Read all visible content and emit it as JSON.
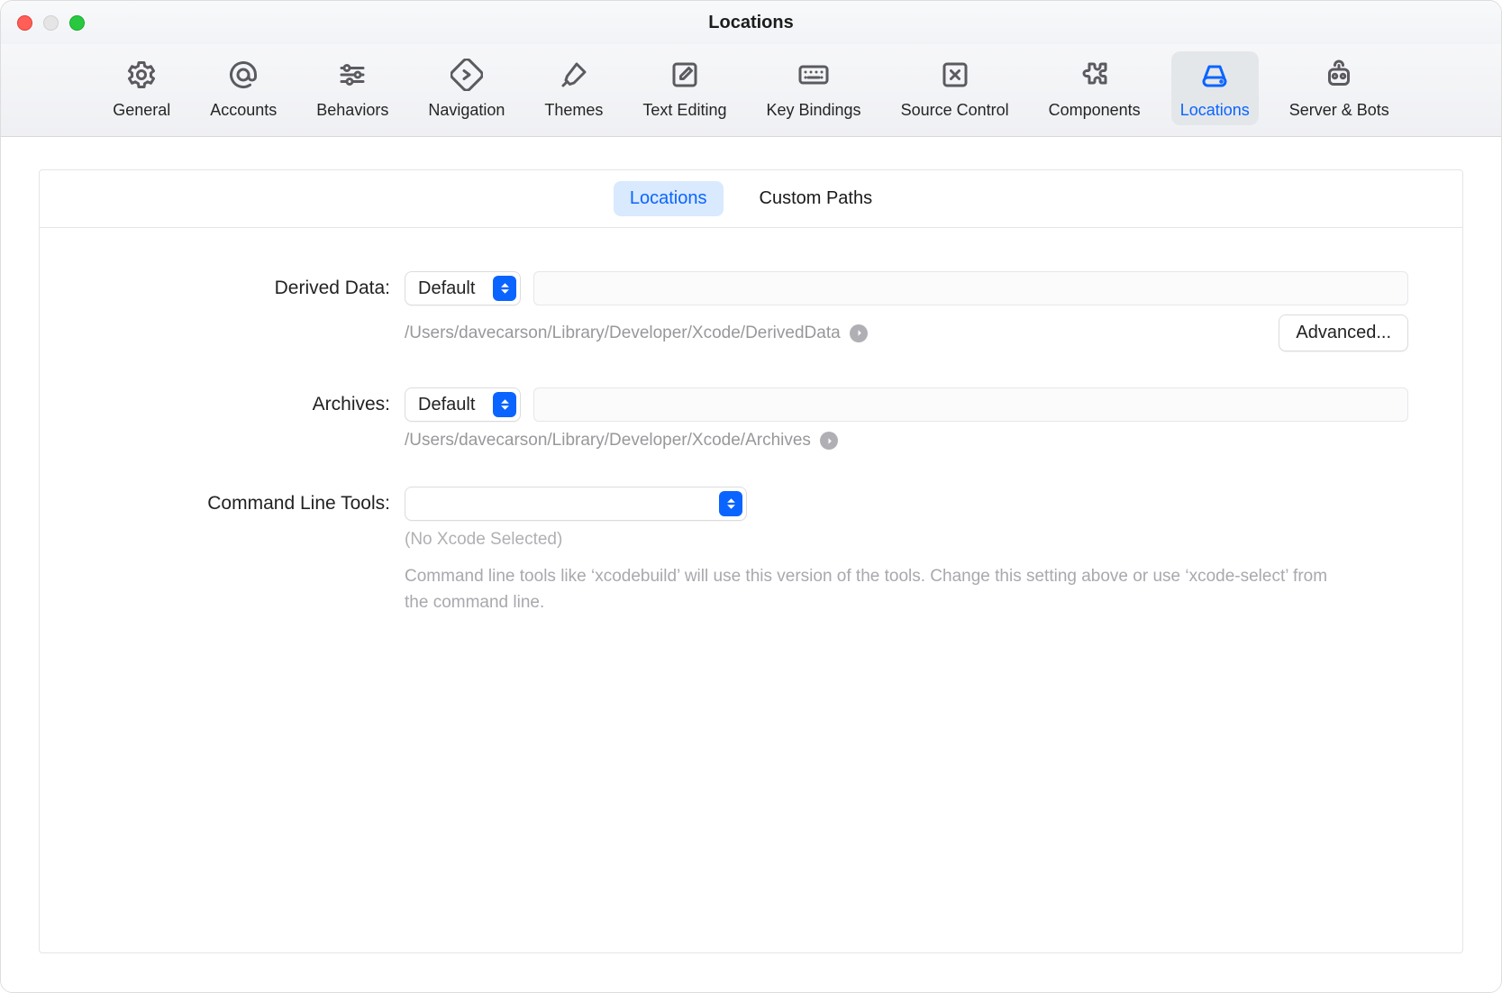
{
  "window": {
    "title": "Locations"
  },
  "toolbar": {
    "items": [
      {
        "label": "General"
      },
      {
        "label": "Accounts"
      },
      {
        "label": "Behaviors"
      },
      {
        "label": "Navigation"
      },
      {
        "label": "Themes"
      },
      {
        "label": "Text Editing"
      },
      {
        "label": "Key Bindings"
      },
      {
        "label": "Source Control"
      },
      {
        "label": "Components"
      },
      {
        "label": "Locations"
      },
      {
        "label": "Server & Bots"
      }
    ]
  },
  "tabs": {
    "locations": "Locations",
    "custom_paths": "Custom Paths"
  },
  "form": {
    "derived_data": {
      "label": "Derived Data:",
      "dropdown": "Default",
      "path": "/Users/davecarson/Library/Developer/Xcode/DerivedData",
      "advanced": "Advanced..."
    },
    "archives": {
      "label": "Archives:",
      "dropdown": "Default",
      "path": "/Users/davecarson/Library/Developer/Xcode/Archives"
    },
    "clt": {
      "label": "Command Line Tools:",
      "dropdown": "",
      "hint": "(No Xcode Selected)",
      "help": "Command line tools like ‘xcodebuild’ will use this version of the tools. Change this setting above or use ‘xcode-select’ from the command line."
    }
  }
}
